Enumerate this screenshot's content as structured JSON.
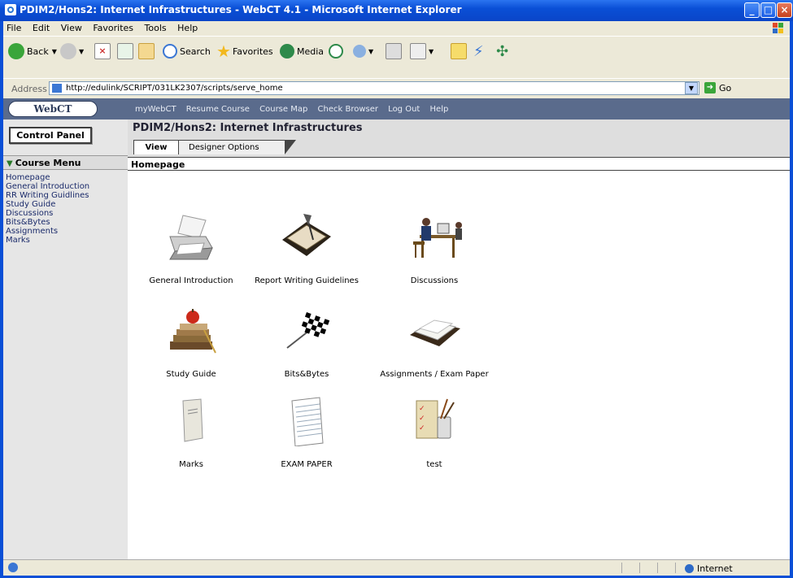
{
  "window": {
    "title": "PDIM2/Hons2: Internet Infrastructures - WebCT 4.1 - Microsoft Internet Explorer"
  },
  "menu": [
    "File",
    "Edit",
    "View",
    "Favorites",
    "Tools",
    "Help"
  ],
  "toolbar": {
    "back": "Back",
    "search": "Search",
    "favorites": "Favorites",
    "media": "Media"
  },
  "address": {
    "label": "Address",
    "url": "http://edulink/SCRIPT/031LK2307/scripts/serve_home",
    "go": "Go"
  },
  "webct": {
    "logo": "WebCT",
    "nav": [
      "myWebCT",
      "Resume Course",
      "Course Map",
      "Check Browser",
      "Log Out",
      "Help"
    ]
  },
  "sidebar": {
    "control_panel": "Control Panel",
    "course_menu": "Course Menu",
    "items": [
      "Homepage",
      "General Introduction",
      "RR Writing Guidlines",
      "Study Guide",
      "Discussions",
      "Bits&Bytes",
      "Assignments",
      "Marks"
    ]
  },
  "header": {
    "course_title": "PDIM2/Hons2: Internet Infrastructures",
    "tab_view": "View",
    "tab_designer": "Designer Options",
    "page_label": "Homepage"
  },
  "tools": [
    {
      "label": "General Introduction",
      "icon": "printer-paper-icon"
    },
    {
      "label": "Report Writing Guidelines",
      "icon": "notebook-quill-icon"
    },
    {
      "label": "Discussions",
      "icon": "people-at-desk-icon"
    },
    {
      "label": "Study Guide",
      "icon": "books-apple-icon"
    },
    {
      "label": "Bits&Bytes",
      "icon": "checkered-flag-icon"
    },
    {
      "label": "Assignments / Exam Paper",
      "icon": "paper-tray-icon"
    },
    {
      "label": "Marks",
      "icon": "booklet-icon"
    },
    {
      "label": "EXAM PAPER",
      "icon": "lined-paper-icon"
    },
    {
      "label": "test",
      "icon": "checklist-pencils-icon"
    }
  ],
  "status": {
    "zone": "Internet"
  }
}
